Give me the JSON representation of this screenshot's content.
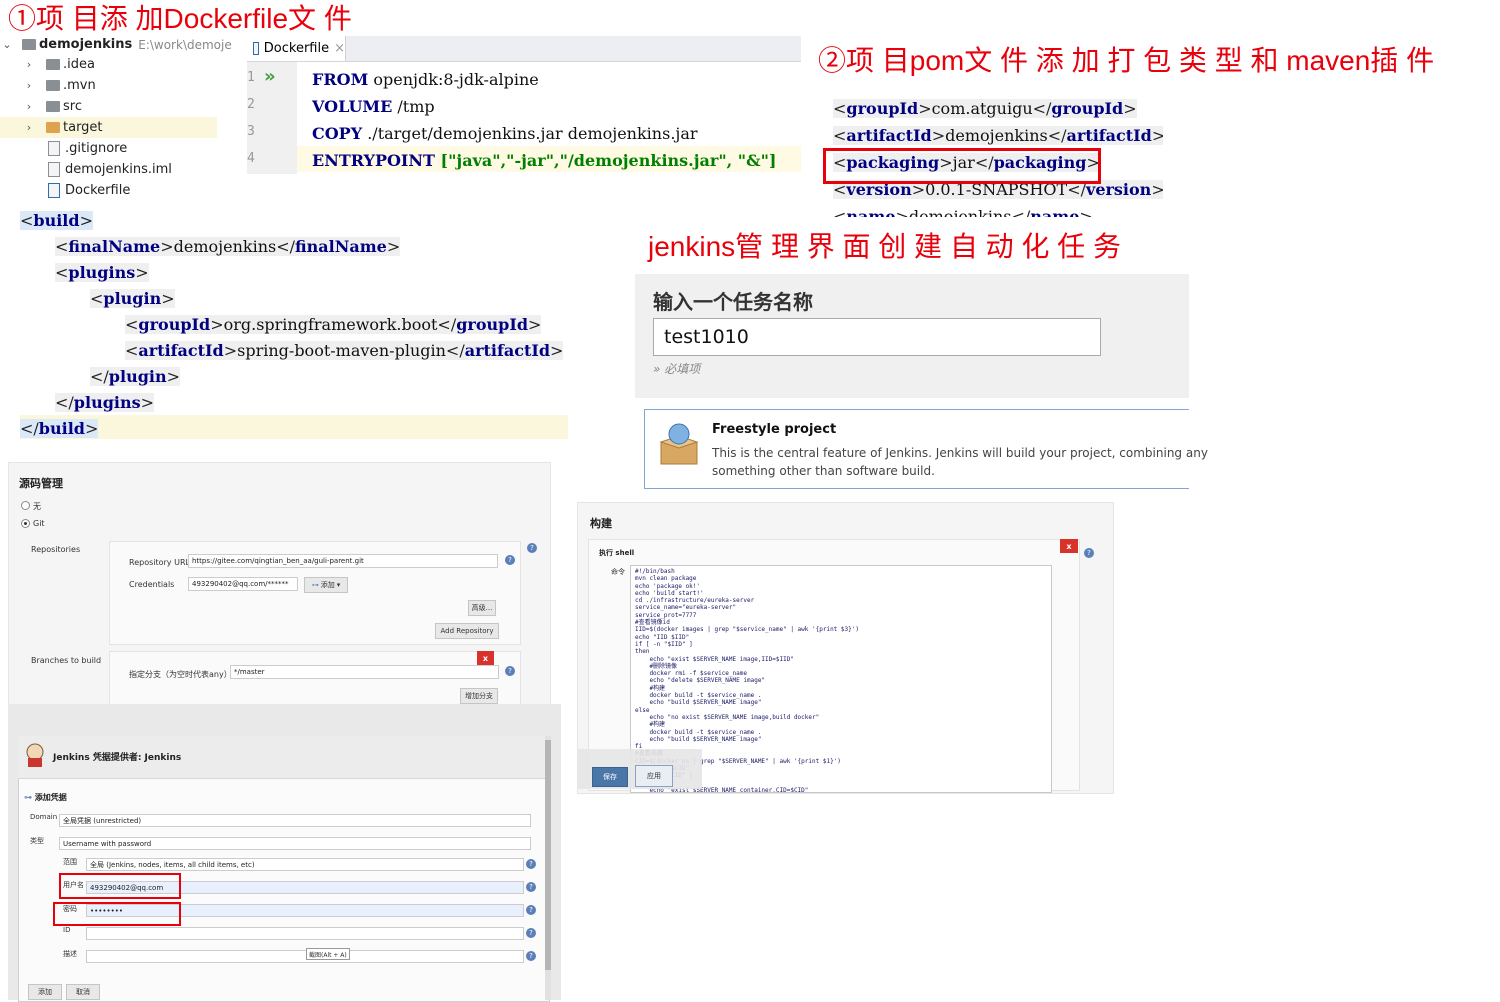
{
  "annotations": {
    "step1": "①项 目添 加Dockerfile文 件",
    "step2": "②项 目pom文 件 添 加 打 包 类 型  和  maven插 件",
    "step3": "jenkins管 理 界 面 创 建 自 动 化 任 务"
  },
  "project_tree": {
    "root_name": "demojenkins",
    "root_path": "E:\\work\\demoje",
    "items": [
      {
        "label": ".idea",
        "type": "folder"
      },
      {
        "label": ".mvn",
        "type": "folder"
      },
      {
        "label": "src",
        "type": "folder"
      },
      {
        "label": "target",
        "type": "folder-orange"
      },
      {
        "label": ".gitignore",
        "type": "file"
      },
      {
        "label": "demojenkins.iml",
        "type": "file"
      },
      {
        "label": "Dockerfile",
        "type": "file"
      }
    ]
  },
  "editor": {
    "tab_label": "Dockerfile",
    "tab_close": "×",
    "line_numbers": [
      "1",
      "2",
      "3",
      "4"
    ],
    "lines": [
      {
        "kw": "FROM",
        "rest": " openjdk:8-jdk-alpine"
      },
      {
        "kw": "VOLUME",
        "rest": " /tmp"
      },
      {
        "kw": "COPY",
        "rest": " ./target/demojenkins.jar demojenkins.jar"
      },
      {
        "kw": "ENTRYPOINT",
        "rest": " [\"java\",\"-jar\",\"/demojenkins.jar\", \"&\"]"
      }
    ]
  },
  "pom": {
    "group_id": "com.atguigu",
    "artifact_id": "demojenkins",
    "packaging": "jar",
    "version": "0.0.1-SNAPSHOT",
    "cut_line": "demojenkins"
  },
  "build_xml": {
    "build": "build",
    "final_name_tag": "finalName",
    "final_name": "demojenkins",
    "plugins": "plugins",
    "plugin": "plugin",
    "group_id_tag": "groupId",
    "group_id": "org.springframework.boot",
    "artifact_id_tag": "artifactId",
    "artifact_id": "spring-boot-maven-plugin"
  },
  "jenkins_new_item": {
    "heading": "输入一个任务名称",
    "item_name": "test1010",
    "required_hint": "» 必填项",
    "freestyle_title": "Freestyle project",
    "freestyle_desc_1": "This is the central feature of Jenkins. Jenkins will build your project, combining any",
    "freestyle_desc_2": "something other than software build."
  },
  "scm": {
    "title": "源码管理",
    "opt_none": "无",
    "opt_git": "Git",
    "repositories_label": "Repositories",
    "repo_url_label": "Repository URL",
    "repo_url": "https://gitee.com/qingtian_ben_aa/guli-parent.git",
    "credentials_label": "Credentials",
    "credentials_value": "493290402@qq.com/******",
    "add_btn": "添加",
    "advanced_btn": "高级...",
    "add_repo_btn": "Add Repository",
    "branches_label": "Branches to build",
    "branch_spec_label": "指定分支（为空时代表any）",
    "branch_value": "*/master",
    "add_branch_btn": "增加分支",
    "x": "x"
  },
  "build_panel": {
    "title": "构建",
    "step_title": "执行 shell",
    "cmd_label": "命令",
    "x": "x",
    "save_btn": "保存",
    "apply_btn": "应用",
    "script": "#!/bin/bash\nmvn clean package\necho 'package ok!'\necho 'build start!'\ncd ./infrastructure/eureka-server\nservice_name=\"eureka-server\"\nservice_prot=7777\n#查看镜像id\nIID=$(docker images | grep \"$service_name\" | awk '{print $3}')\necho \"IID $IID\"\nif [ -n \"$IID\" ]\nthen\n    echo \"exist $SERVER_NAME image,IID=$IID\"\n    #删除镜像\n    docker rmi -f $service_name\n    echo \"delete $SERVER_NAME image\"\n    #构建\n    docker build -t $service_name .\n    echo \"build $SERVER_NAME image\"\nelse\n    echo \"no exist $SERVER_NAME image,build docker\"\n    #构建\n    docker build -t $service_name .\n    echo \"build $SERVER_NAME image\"\nfi\n#查看容器\nCID=$(docker ps | grep \"$SERVER_NAME\" | awk '{print $1}')\necho \"CID $CID\"\nif [ -n \"$CID\" ]\n\n    echo \"exist $SERVER_NAME container,CID=$CID\""
  },
  "credentials_dialog": {
    "title": "Jenkins 凭据提供者: Jenkins",
    "section": "添加凭据",
    "domain_label": "Domain",
    "domain_value": "全局凭据 (unrestricted)",
    "kind_label": "类型",
    "kind_value": "Username with password",
    "scope_label": "范围",
    "scope_value": "全局 (Jenkins, nodes, items, all child items, etc)",
    "username_label": "用户名",
    "username_value": "493290402@qq.com",
    "password_label": "密码",
    "password_value": "••••••••",
    "id_label": "ID",
    "desc_label": "描述",
    "screenshot_hint": "截图(Alt + A)",
    "add_btn": "添加",
    "cancel_btn": "取消"
  },
  "colors": {
    "annotation_red": "#e8000b",
    "xml_tag": "#000080",
    "string_green": "#008000"
  }
}
